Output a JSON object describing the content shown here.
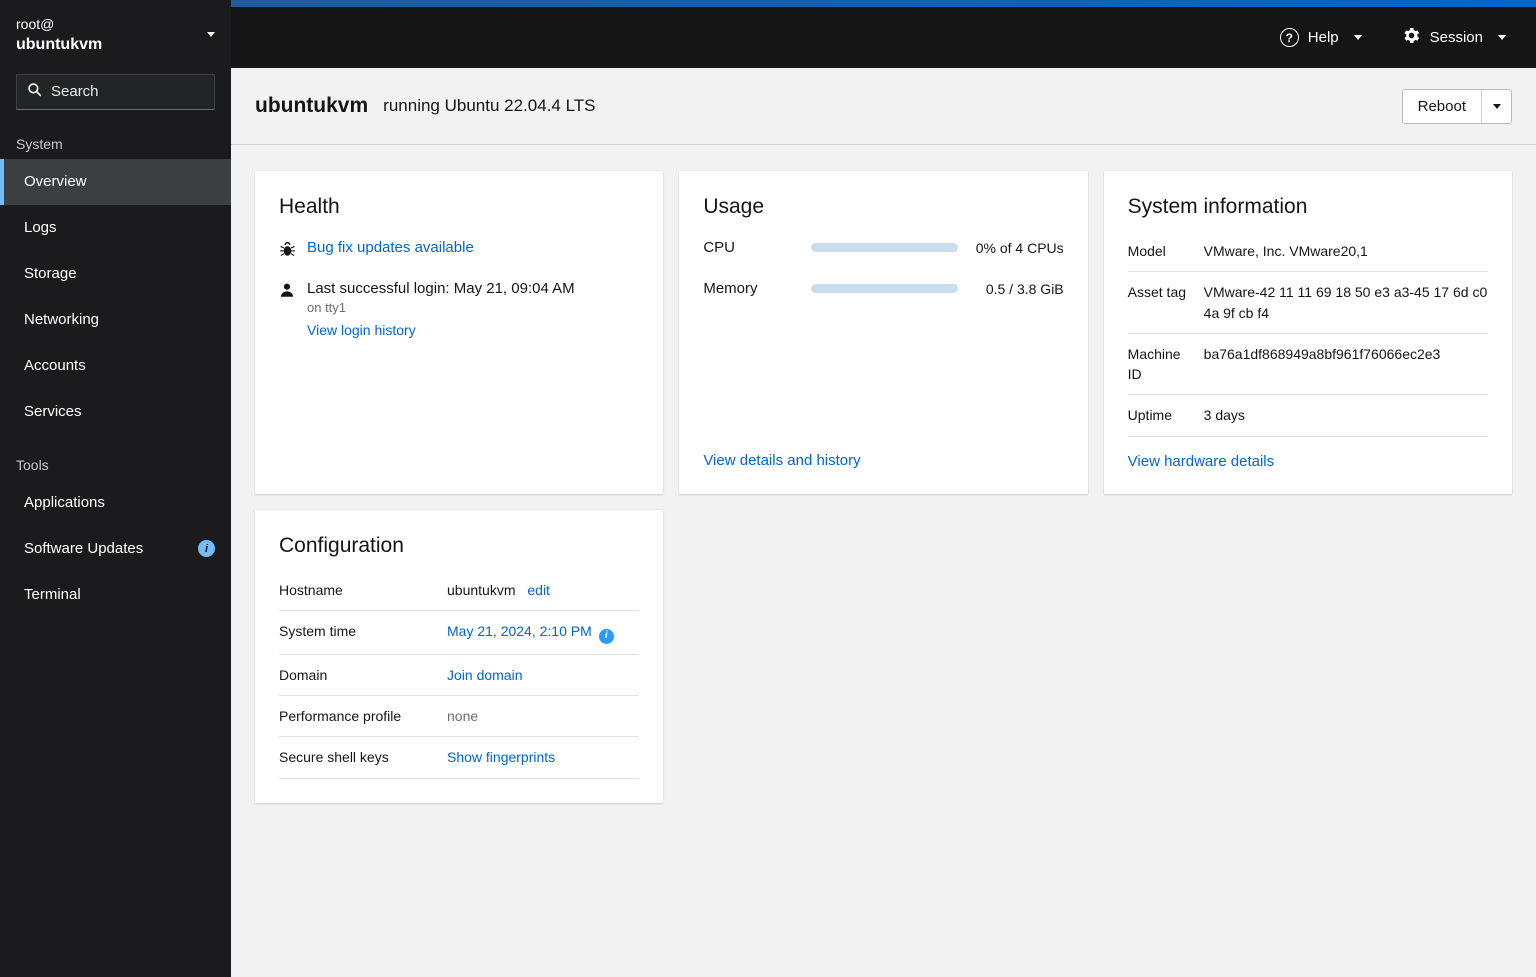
{
  "colors": {
    "accent": "#0066cc",
    "link": "#0066cc",
    "masthead-bg": "#151515",
    "sidebar-bg": "#1b1b1d",
    "sidebar-current": "#3c3f42",
    "sidebar-current-border": "#73bcf7",
    "content-bg": "#f2f2f2",
    "card-bg": "#ffffff",
    "text": "#151515",
    "muted": "#6a6e73",
    "border": "#d2d2d2",
    "progress-track": "#c9ddef",
    "info": "#2b9af3"
  },
  "sidebar": {
    "user": "root@",
    "host": "ubuntukvm",
    "search": {
      "placeholder": "Search"
    },
    "sections": [
      {
        "label": "System",
        "items": [
          {
            "label": "Overview",
            "current": true
          },
          {
            "label": "Logs"
          },
          {
            "label": "Storage"
          },
          {
            "label": "Networking"
          },
          {
            "label": "Accounts"
          },
          {
            "label": "Services"
          }
        ]
      },
      {
        "label": "Tools",
        "items": [
          {
            "label": "Applications"
          },
          {
            "label": "Software Updates",
            "badge": "i"
          },
          {
            "label": "Terminal"
          }
        ]
      }
    ]
  },
  "masthead": {
    "help": {
      "label": "Help"
    },
    "session": {
      "label": "Session"
    }
  },
  "page_header": {
    "hostname": "ubuntukvm",
    "subtitle": "running Ubuntu 22.04.4 LTS",
    "reboot_label": "Reboot"
  },
  "health": {
    "title": "Health",
    "updates_link": "Bug fix updates available",
    "last_login": "Last successful login: May 21, 09:04 AM",
    "last_login_detail": "on tty1",
    "login_history_link": "View login history"
  },
  "usage": {
    "title": "Usage",
    "cpu": {
      "label": "CPU",
      "value": "0% of 4 CPUs",
      "percent": 2
    },
    "memory": {
      "label": "Memory",
      "value": "0.5 / 3.8 GiB",
      "percent": 13
    },
    "details_link": "View details and history"
  },
  "system_information": {
    "title": "System information",
    "rows": [
      {
        "label": "Model",
        "value": "VMware, Inc. VMware20,1"
      },
      {
        "label": "Asset tag",
        "value": "VMware-42 11 11 69 18 50 e3 a3-45 17 6d c0 4a 9f cb f4"
      },
      {
        "label": "Machine ID",
        "value": "ba76a1df868949a8bf961f76066ec2e3"
      },
      {
        "label": "Uptime",
        "value": "3 days"
      }
    ],
    "hardware_link": "View hardware details"
  },
  "configuration": {
    "title": "Configuration",
    "rows": [
      {
        "label": "Hostname",
        "value": "ubuntukvm",
        "action": "edit"
      },
      {
        "label": "System time",
        "value": "May 21, 2024, 2:10 PM",
        "info": true
      },
      {
        "label": "Domain",
        "value": "Join domain"
      },
      {
        "label": "Performance profile",
        "value": "none"
      },
      {
        "label": "Secure shell keys",
        "value": "Show fingerprints"
      }
    ]
  }
}
